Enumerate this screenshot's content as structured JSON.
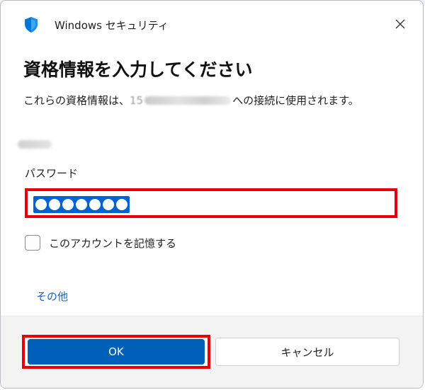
{
  "window": {
    "app_title": "Windows セキュリティ",
    "close_glyph": "✕"
  },
  "main": {
    "heading": "資格情報を入力してください",
    "description_prefix": "これらの資格情報は、",
    "description_visible_fragment": "15",
    "description_suffix": "への接続に使用されます。",
    "password_label": "パスワード",
    "password_masked_count": 7,
    "remember_label": "このアカウントを記憶する",
    "remember_checked": false,
    "more_link": "その他"
  },
  "footer": {
    "ok_label": "OK",
    "cancel_label": "キャンセル"
  },
  "colors": {
    "accent": "#005fb8",
    "highlight": "#e8000b",
    "link": "#1a5fb4",
    "shield": "#0078d4"
  },
  "icons": {
    "app": "shield-icon",
    "close": "close-icon",
    "checkbox": "checkbox-icon"
  }
}
